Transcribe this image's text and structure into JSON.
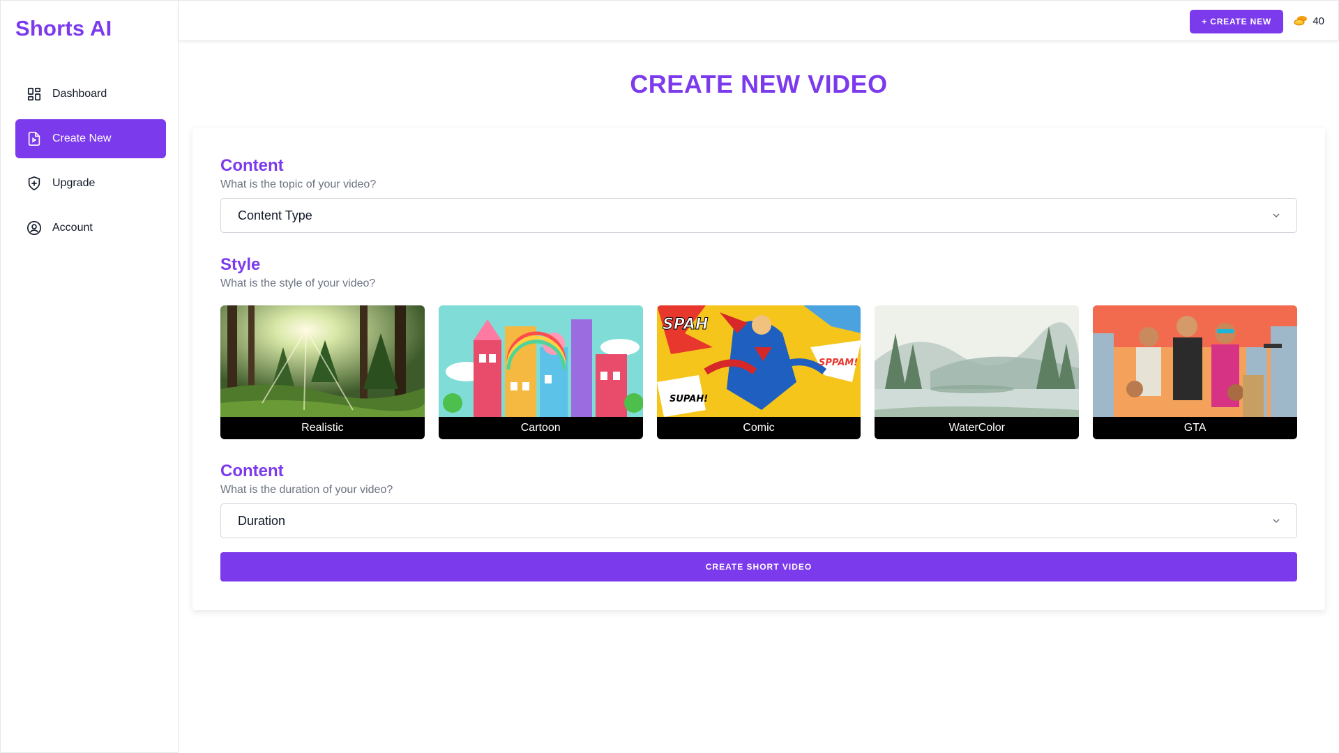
{
  "app": {
    "title": "Shorts AI"
  },
  "sidebar": {
    "items": [
      {
        "label": "Dashboard",
        "icon": "dashboard-grid-icon"
      },
      {
        "label": "Create New",
        "icon": "file-video-icon",
        "active": true
      },
      {
        "label": "Upgrade",
        "icon": "shield-plus-icon"
      },
      {
        "label": "Account",
        "icon": "user-circle-icon"
      }
    ]
  },
  "header": {
    "create_label": "+ CREATE NEW",
    "credits": "40",
    "credits_icon": "coins-icon"
  },
  "main": {
    "title": "CREATE NEW VIDEO",
    "content_section": {
      "title": "Content",
      "subtitle": "What is the topic of your video?",
      "placeholder": "Content Type"
    },
    "style_section": {
      "title": "Style",
      "subtitle": "What is the style of your video?",
      "options": [
        {
          "label": "Realistic"
        },
        {
          "label": "Cartoon"
        },
        {
          "label": "Comic"
        },
        {
          "label": "WaterColor"
        },
        {
          "label": "GTA"
        }
      ]
    },
    "duration_section": {
      "title": "Content",
      "subtitle": "What is the duration of your video?",
      "placeholder": "Duration"
    },
    "submit_label": "CREATE SHORT VIDEO"
  },
  "colors": {
    "accent": "#7c3aed",
    "text": "#111827",
    "muted": "#6b7280",
    "border": "#d1d5db"
  }
}
